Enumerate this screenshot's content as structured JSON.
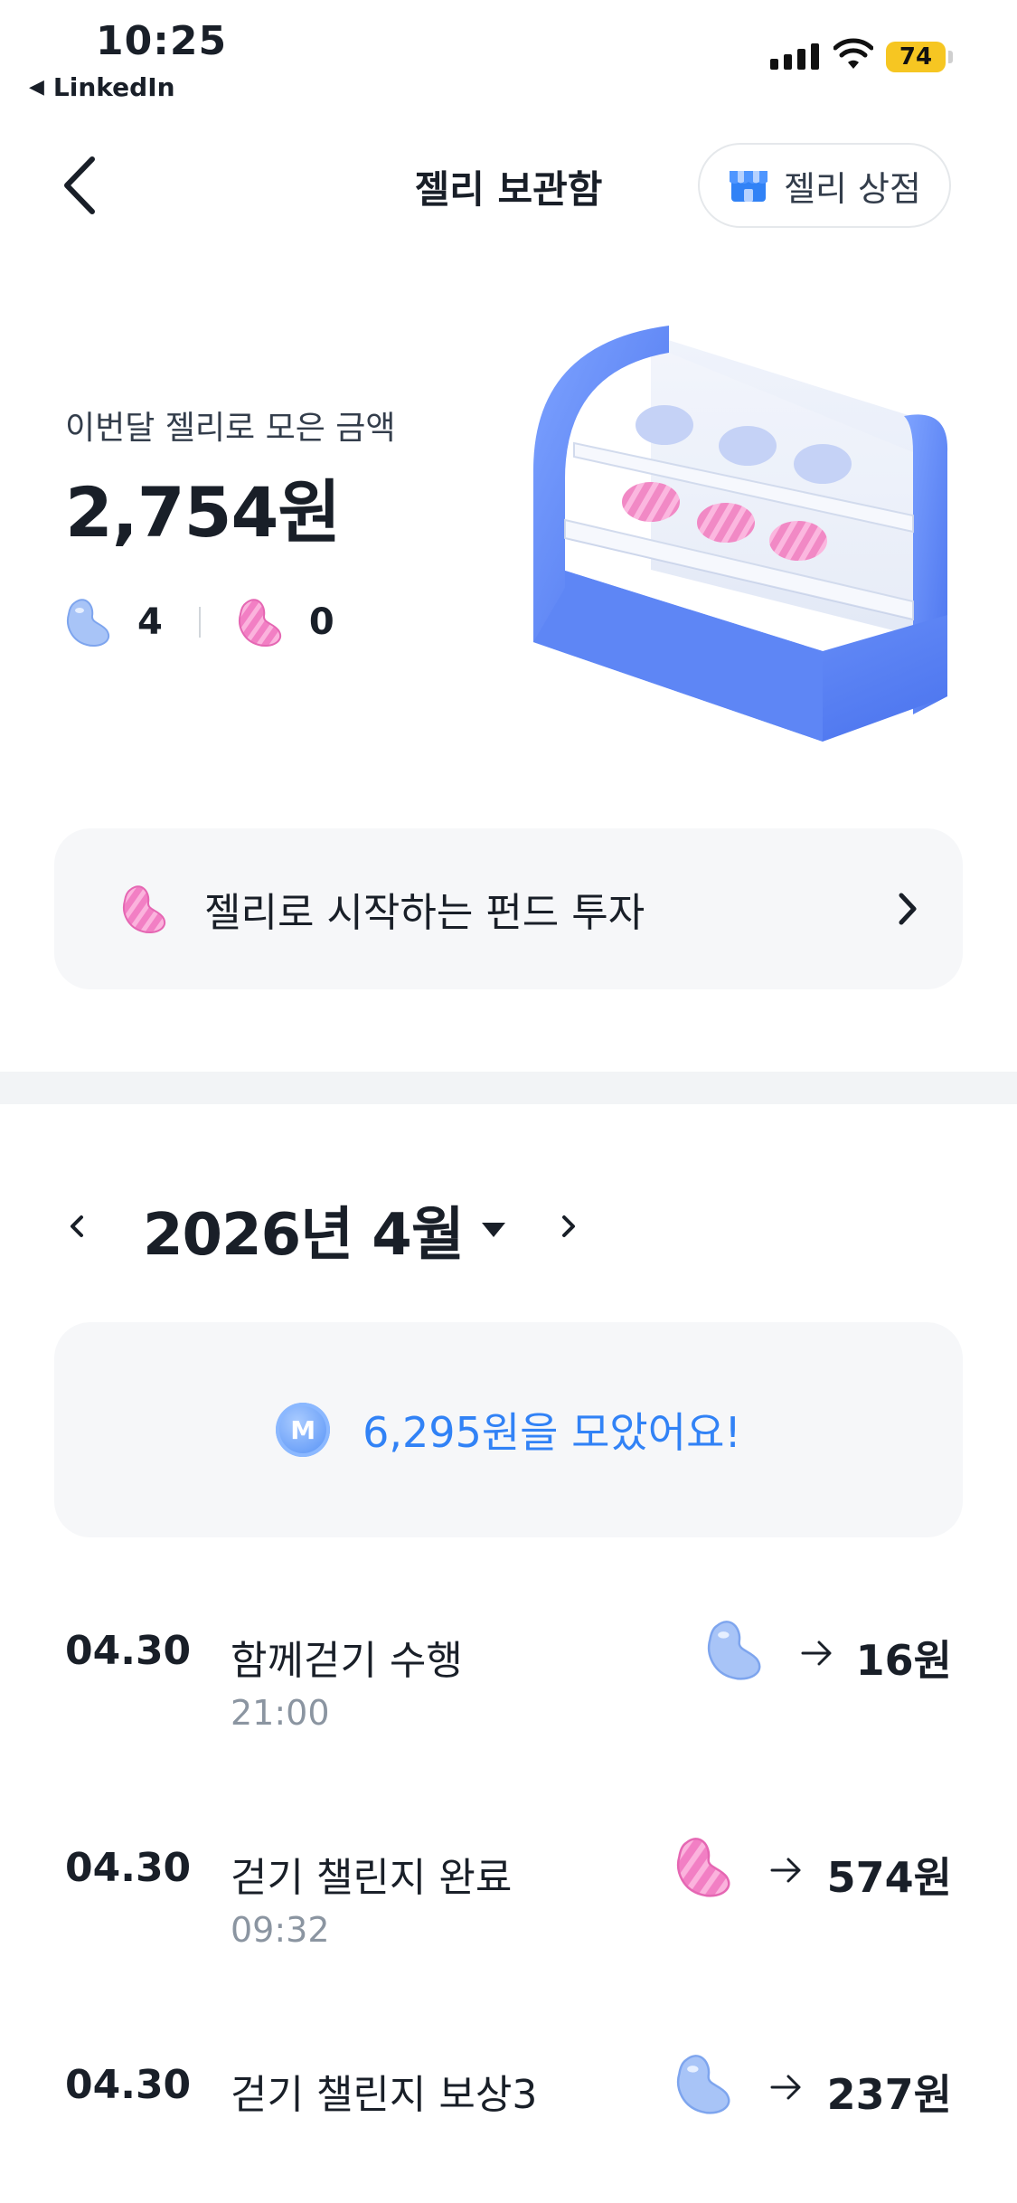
{
  "status_bar": {
    "time": "10:25",
    "back_app": "LinkedIn",
    "battery": "74"
  },
  "header": {
    "title": "젤리 보관함",
    "store_button": "젤리 상점"
  },
  "summary": {
    "label": "이번달 젤리로 모은 금액",
    "amount": "2,754원",
    "blue_jelly_count": "4",
    "pink_jelly_count": "0"
  },
  "fund_banner": {
    "text": "젤리로 시작하는 펀드 투자"
  },
  "month_nav": {
    "label": "2026년 4월"
  },
  "saved_box": {
    "coin_icon": "M",
    "text": "6,295원을 모았어요!"
  },
  "history": [
    {
      "date": "04.30",
      "title": "함께걷기 수행",
      "time": "21:00",
      "jelly": "blue",
      "amount": "16원"
    },
    {
      "date": "04.30",
      "title": "걷기 챌린지 완료",
      "time": "09:32",
      "jelly": "pink",
      "amount": "574원"
    },
    {
      "date": "04.30",
      "title": "걷기 챌린지 보상3",
      "time": "",
      "jelly": "blue",
      "amount": "237원"
    }
  ],
  "colors": {
    "accent": "#3182f6",
    "blue_jelly": "#a8c4f7",
    "pink_jelly": "#f27fc4",
    "banner_bg": "#f6f7f9"
  }
}
